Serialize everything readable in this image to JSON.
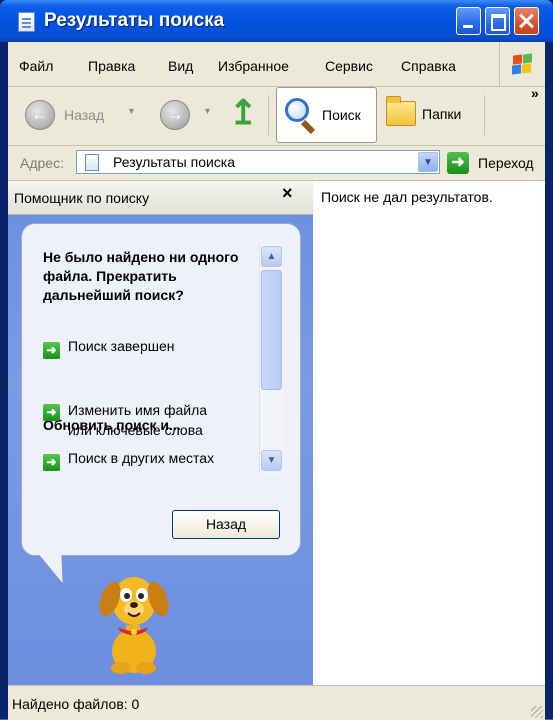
{
  "window": {
    "title": "Результаты поиска"
  },
  "menu": [
    "Файл",
    "Правка",
    "Вид",
    "Избранное",
    "Сервис",
    "Справка"
  ],
  "toolbar": {
    "back_label": "Назад",
    "search_label": "Поиск",
    "folders_label": "Папки",
    "overflow": "»"
  },
  "address": {
    "label": "Адрес:",
    "value": "Результаты поиска",
    "go_label": "Переход"
  },
  "helper": {
    "title": "Помощник по поиску",
    "close": "×",
    "question": "Не было найдено ни одного файла. Прекратить дальнейший поиск?",
    "finish": "Поиск завершен",
    "refine_heading": "Обновить поиск и...",
    "change_name": "Изменить имя файла\nили ключевые слова",
    "search_elsewhere": "Поиск в других местах",
    "back_button": "Назад"
  },
  "results": {
    "message": "Поиск не дал результатов."
  },
  "status": {
    "text": "Найдено файлов: 0"
  },
  "colors": {
    "titlebar": "#0054e3",
    "helper_bg": "#7a9ae4",
    "chrome": "#ece9d8"
  }
}
